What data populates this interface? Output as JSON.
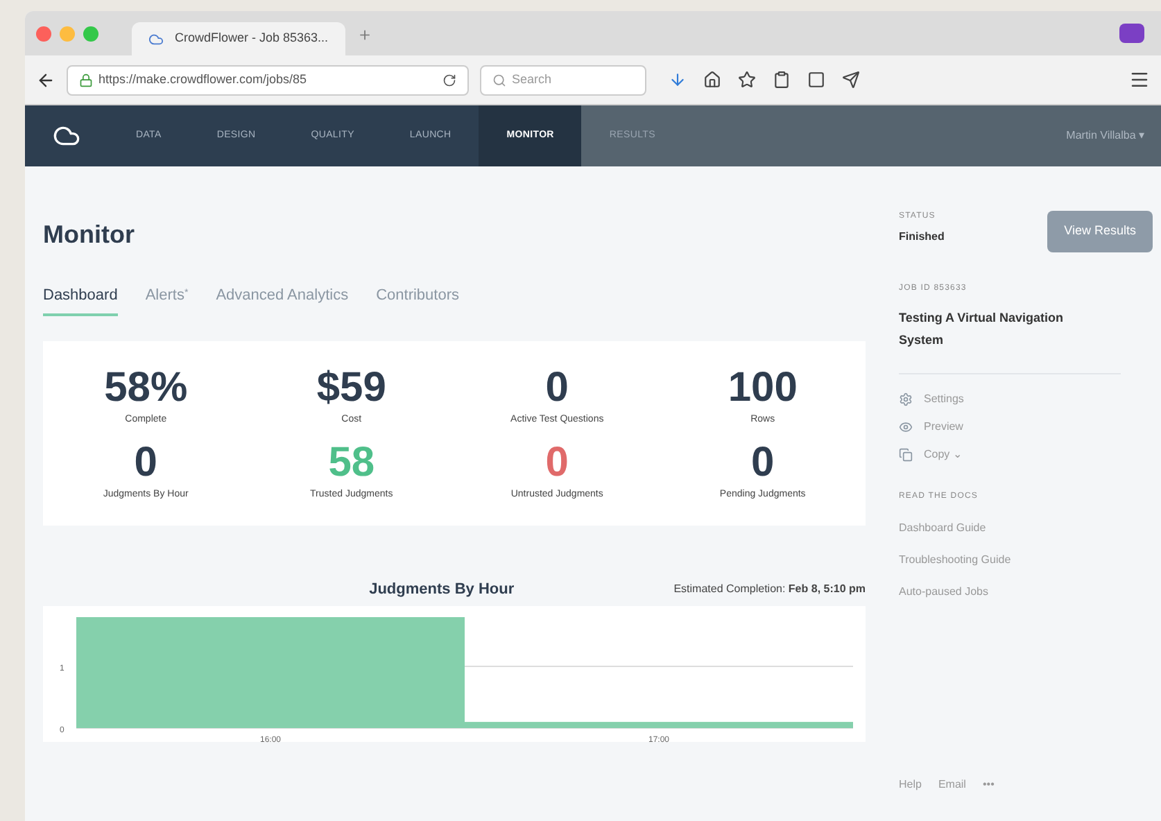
{
  "browser": {
    "tab_title": "CrowdFlower - Job 85363...",
    "url": "https://make.crowdflower.com/jobs/85",
    "search_placeholder": "Search",
    "new_tab": "＋"
  },
  "nav": {
    "items": [
      {
        "label": "DATA",
        "selected": false,
        "disabled": false
      },
      {
        "label": "DESIGN",
        "selected": false,
        "disabled": false
      },
      {
        "label": "QUALITY",
        "selected": false,
        "disabled": false
      },
      {
        "label": "LAUNCH",
        "selected": false,
        "disabled": false
      },
      {
        "label": "MONITOR",
        "selected": true,
        "disabled": false
      },
      {
        "label": "RESULTS",
        "selected": false,
        "disabled": true
      }
    ],
    "user": "Martin Villalba ▾"
  },
  "page": {
    "title": "Monitor",
    "tabs": [
      {
        "label": "Dashboard",
        "selected": true
      },
      {
        "label": "Alerts",
        "selected": false,
        "badge": "*"
      },
      {
        "label": "Advanced Analytics",
        "selected": false
      },
      {
        "label": "Contributors",
        "selected": false
      }
    ]
  },
  "stats": [
    {
      "value": "58%",
      "label": "Complete",
      "color": "#2f3d4f"
    },
    {
      "value": "$59",
      "label": "Cost",
      "color": "#2f3d4f"
    },
    {
      "value": "0",
      "label": "Active Test Questions",
      "color": "#2f3d4f"
    },
    {
      "value": "100",
      "label": "Rows",
      "color": "#2f3d4f"
    },
    {
      "value": "0",
      "label": "Judgments By Hour",
      "color": "#2f3d4f"
    },
    {
      "value": "58",
      "label": "Trusted Judgments",
      "color": "#4fbf8a"
    },
    {
      "value": "0",
      "label": "Untrusted Judgments",
      "color": "#e06a6a"
    },
    {
      "value": "0",
      "label": "Pending Judgments",
      "color": "#2f3d4f"
    }
  ],
  "chart": {
    "estimate_label": "Estimated Completion:",
    "estimate_value": "Feb 8, 5:10 pm",
    "chart_data": {
      "type": "bar",
      "title": "Judgments By Hour",
      "categories": [
        "16:00",
        "17:00"
      ],
      "series": [
        {
          "color": "#85d0ac",
          "values": [
            1.8,
            0.1
          ]
        }
      ],
      "ylim": [
        0,
        1.8
      ],
      "yticks": [
        0,
        1
      ]
    }
  },
  "sidebar": {
    "status_label": "STATUS",
    "status": "Finished",
    "view_results": "View Results",
    "job_label": "JOB ID 853633",
    "job_name": "Testing A Virtual Navigation System",
    "actions": [
      {
        "kind": "settings",
        "label": "Settings"
      },
      {
        "kind": "preview",
        "label": "Preview"
      },
      {
        "kind": "copy",
        "label": "Copy ⌄"
      }
    ],
    "docs_label": "READ THE DOCS",
    "docs": [
      "Dashboard Guide",
      "Troubleshooting Guide",
      "Auto-paused Jobs"
    ],
    "footer": [
      "Help",
      "Email",
      "•••"
    ]
  }
}
